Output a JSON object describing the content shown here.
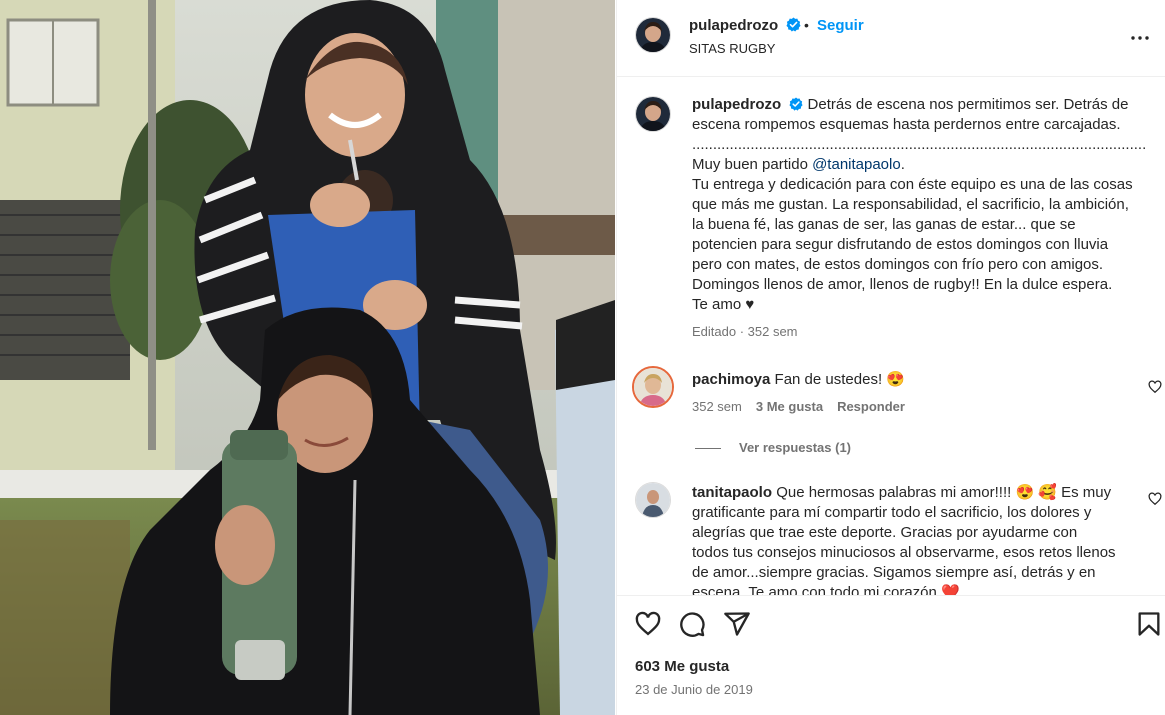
{
  "post": {
    "username": "pulapedrozo",
    "follow_label": "Seguir",
    "separator": "•",
    "subtitle": "SITAS RUGBY",
    "caption": {
      "line1_rest": "Detrás de escena nos permitimos ser. Detrás de",
      "line2": "escena rompemos esquemas hasta perdernos entre carcajadas.",
      "divider": "..............................................................................................................",
      "line4_pre": "Muy buen partido ",
      "mention": "@tanitapaolo",
      "line4_post": ".",
      "line5": "Tu entrega y dedicación para con éste equipo es una de las cosas",
      "line6": "que más me gustan. La responsabilidad, el sacrificio, la ambición,",
      "line7": "la buena fé, las ganas de ser, las ganas de estar... que se",
      "line8": "potencien para segur disfrutando de estos domingos con lluvia",
      "line9": "pero con mates, de estos domingos con frío pero con amigos.",
      "line10": "Domingos llenos de amor, llenos de rugby!! En la dulce espera.",
      "line11": "Te amo ♥"
    },
    "caption_meta": "Editado · 352 sem"
  },
  "comments": [
    {
      "username": "pachimoya",
      "text": "Fan de ustedes! 😍",
      "time": "352 sem",
      "likes": "3 Me gusta",
      "reply_label": "Responder",
      "view_replies": "Ver respuestas (1)"
    },
    {
      "username": "tanitapaolo",
      "line1": "Que hermosas palabras mi amor!!!! 😍 🥰 Es muy",
      "line2": "gratificante para mí compartir todo el sacrificio, los dolores y",
      "line3": "alegrías que trae este deporte. Gracias por ayudarme con",
      "line4": "todos tus consejos minuciosos al observarme, esos retos llenos",
      "line5": "de amor...siempre gracias. Sigamos siempre así, detrás y en",
      "line6": "escena. Te amo con todo mi corazón ❤️"
    }
  ],
  "footer": {
    "likes": "603 Me gusta",
    "date": "23 de Junio de 2019"
  },
  "icons": {
    "like": "heart-icon",
    "comment": "comment-icon",
    "share": "share-icon",
    "save": "bookmark-icon",
    "more": "more-options-icon",
    "verified": "verified-badge-icon"
  },
  "colors": {
    "accent": "#0095f6",
    "mention": "#00376b",
    "secondary_text": "#737373"
  }
}
